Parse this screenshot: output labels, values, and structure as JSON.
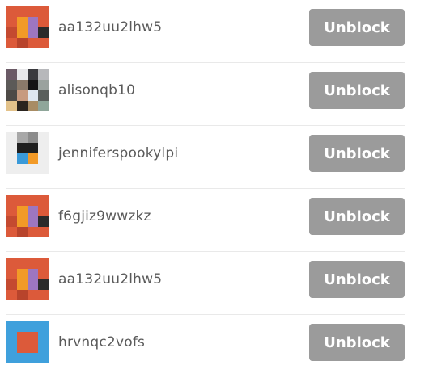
{
  "blocked_users": [
    {
      "username": "aa132uu2lhw5",
      "avatar": "avatar-orange-pixel",
      "button_label": "Unblock"
    },
    {
      "username": "alisonqb10",
      "avatar": "avatar-photo-mosaic",
      "button_label": "Unblock"
    },
    {
      "username": "jenniferspookylpi",
      "avatar": "avatar-gray-pixel",
      "button_label": "Unblock"
    },
    {
      "username": "f6gjiz9wwzkz",
      "avatar": "avatar-orange-pixel",
      "button_label": "Unblock"
    },
    {
      "username": "aa132uu2lhw5",
      "avatar": "avatar-orange-pixel",
      "button_label": "Unblock"
    },
    {
      "username": "hrvnqc2vofs",
      "avatar": "avatar-blue-square",
      "button_label": "Unblock"
    }
  ],
  "colors": {
    "button_background": "#9b9b9b",
    "button_text": "#ffffff",
    "username_text": "#5a5a5a",
    "divider": "#e9e9e9"
  }
}
